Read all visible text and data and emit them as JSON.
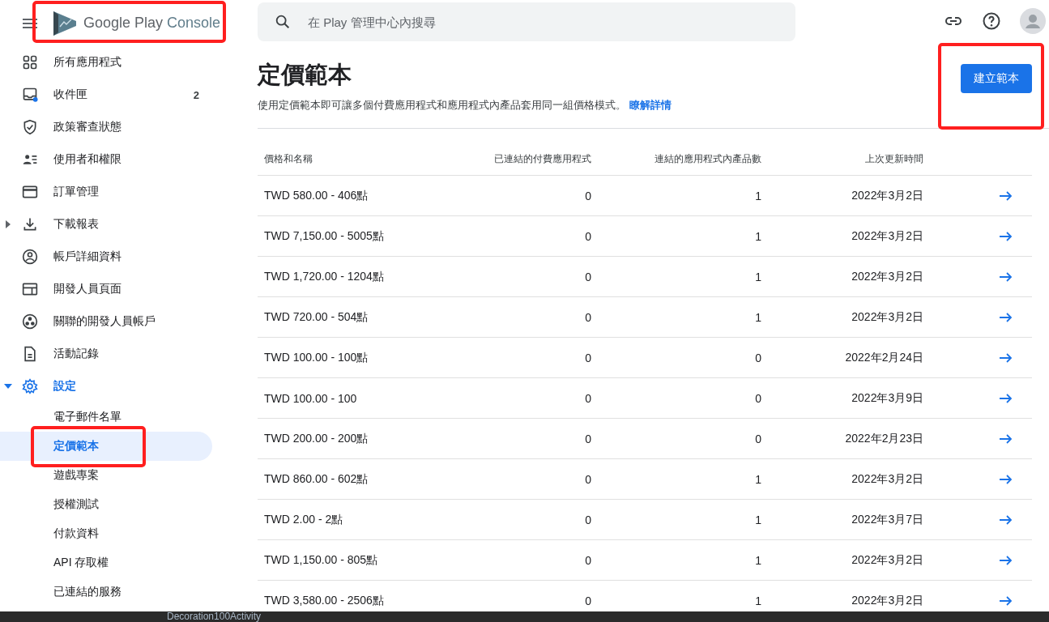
{
  "header": {
    "logo_text": "Google Play",
    "logo_product": "Console",
    "search": {
      "placeholder": "在 Play 管理中心內搜尋"
    }
  },
  "sidebar": {
    "items": [
      {
        "label": "所有應用程式",
        "kind": "item"
      },
      {
        "label": "收件匣",
        "kind": "item",
        "badge": "2",
        "unread": true
      },
      {
        "label": "政策審查狀態",
        "kind": "item"
      },
      {
        "label": "使用者和權限",
        "kind": "item"
      },
      {
        "label": "訂單管理",
        "kind": "item"
      },
      {
        "label": "下載報表",
        "kind": "group",
        "expanded": false
      },
      {
        "label": "帳戶詳細資料",
        "kind": "item"
      },
      {
        "label": "開發人員頁面",
        "kind": "item"
      },
      {
        "label": "關聯的開發人員帳戶",
        "kind": "item"
      },
      {
        "label": "活動記錄",
        "kind": "item"
      },
      {
        "label": "設定",
        "kind": "group",
        "expanded": true,
        "children": [
          {
            "label": "電子郵件名單",
            "selected": false
          },
          {
            "label": "定價範本",
            "selected": true
          },
          {
            "label": "遊戲專案",
            "selected": false
          },
          {
            "label": "授權測試",
            "selected": false
          },
          {
            "label": "付款資料",
            "selected": false
          },
          {
            "label": "API 存取權",
            "selected": false
          },
          {
            "label": "已連結的服務",
            "selected": false
          }
        ]
      }
    ]
  },
  "page": {
    "title": "定價範本",
    "description": "使用定價範本即可讓多個付費應用程式和應用程式內產品套用同一組價格模式。",
    "learn_more": "瞭解詳情",
    "create_button": "建立範本"
  },
  "table": {
    "columns": [
      "價格和名稱",
      "已連結的付費應用程式",
      "連結的應用程式內產品數",
      "上次更新時間"
    ],
    "rows": [
      {
        "name": "TWD 580.00 - 406點",
        "linked_apps": "0",
        "linked_products": "1",
        "updated": "2022年3月2日"
      },
      {
        "name": "TWD 7,150.00 - 5005點",
        "linked_apps": "0",
        "linked_products": "1",
        "updated": "2022年3月2日"
      },
      {
        "name": "TWD 1,720.00 - 1204點",
        "linked_apps": "0",
        "linked_products": "1",
        "updated": "2022年3月2日"
      },
      {
        "name": "TWD 720.00 - 504點",
        "linked_apps": "0",
        "linked_products": "1",
        "updated": "2022年3月2日"
      },
      {
        "name": "TWD 100.00 - 100點",
        "linked_apps": "0",
        "linked_products": "0",
        "updated": "2022年2月24日"
      },
      {
        "name": "TWD 100.00 - 100",
        "linked_apps": "0",
        "linked_products": "0",
        "updated": "2022年3月9日"
      },
      {
        "name": "TWD 200.00 - 200點",
        "linked_apps": "0",
        "linked_products": "0",
        "updated": "2022年2月23日"
      },
      {
        "name": "TWD 860.00 - 602點",
        "linked_apps": "0",
        "linked_products": "1",
        "updated": "2022年3月2日"
      },
      {
        "name": "TWD 2.00 - 2點",
        "linked_apps": "0",
        "linked_products": "1",
        "updated": "2022年3月7日"
      },
      {
        "name": "TWD 1,150.00 - 805點",
        "linked_apps": "0",
        "linked_products": "1",
        "updated": "2022年3月2日"
      },
      {
        "name": "TWD 3,580.00 - 2506點",
        "linked_apps": "0",
        "linked_products": "1",
        "updated": "2022年3月2日"
      }
    ]
  },
  "taskbar": {
    "window_title": "Decoration100Activity"
  }
}
